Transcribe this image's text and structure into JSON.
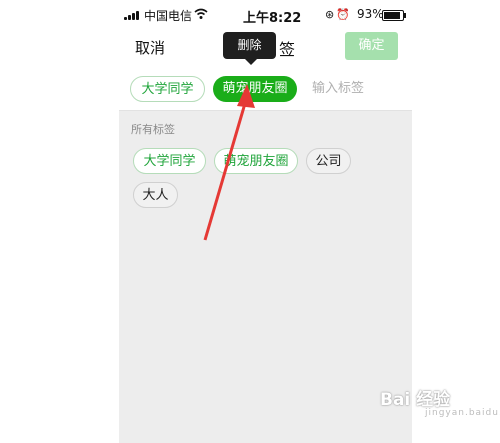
{
  "status_bar": {
    "carrier": "中国电信",
    "time": "上午8:22",
    "battery_percent": "93%",
    "battery_level": 0.93
  },
  "navbar": {
    "cancel": "取消",
    "title_fragment": "签",
    "confirm": "确定"
  },
  "tooltip": {
    "label": "删除"
  },
  "selected_tags": [
    {
      "label": "大学同学",
      "state": "normal"
    },
    {
      "label": "萌宠朋友圈",
      "state": "selected"
    }
  ],
  "input": {
    "placeholder": "输入标签"
  },
  "all_tags": {
    "section_label": "所有标签",
    "tags": [
      "大学同学",
      "萌宠朋友圈",
      "公司",
      "大人"
    ]
  },
  "watermark": {
    "text": "Bai 经验",
    "sub": "jingyan.baidu.com"
  },
  "colors": {
    "accent": "#1aad19",
    "accent_outline_text": "#1fa43a",
    "confirm_disabled": "#a5e0ad",
    "arrow": "#e53935"
  },
  "icons": [
    "signal-icon",
    "wifi-icon",
    "orientation-lock-icon",
    "alarm-icon",
    "battery-icon",
    "red-arrow-annotation"
  ]
}
